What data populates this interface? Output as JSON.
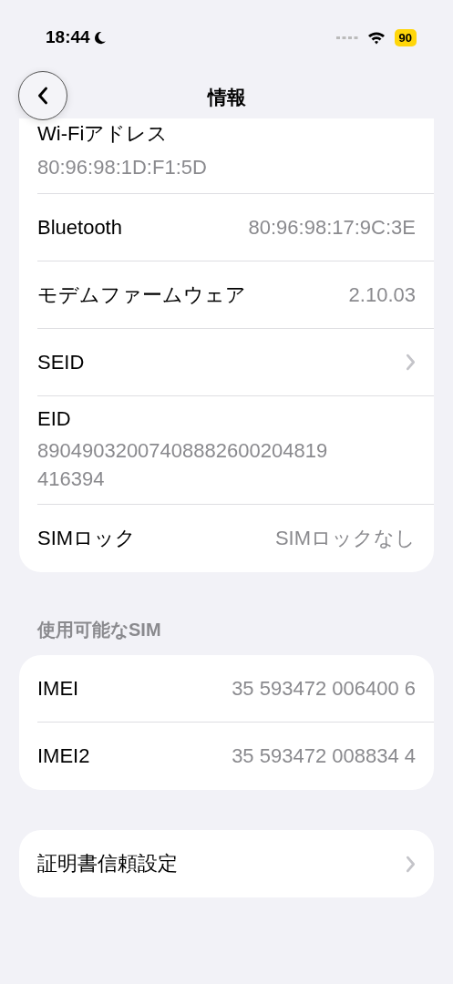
{
  "status_bar": {
    "time": "18:44",
    "battery": "90"
  },
  "nav": {
    "title": "情報"
  },
  "groups": [
    {
      "rows": [
        {
          "kind": "stacked",
          "label": "Wi-Fiアドレス",
          "value": "80:96:98:1D:F1:5D"
        },
        {
          "kind": "value",
          "label": "Bluetooth",
          "value": "80:96:98:17:9C:3E"
        },
        {
          "kind": "value",
          "label": "モデムファームウェア",
          "value": "2.10.03"
        },
        {
          "kind": "link",
          "label": "SEID"
        },
        {
          "kind": "stacked",
          "label": "EID",
          "value": "89049032007408882600204819416394"
        },
        {
          "kind": "value",
          "label": "SIMロック",
          "value": "SIMロックなし"
        }
      ]
    },
    {
      "header": "使用可能なSIM",
      "rows": [
        {
          "kind": "value",
          "label": "IMEI",
          "value": "35 593472 006400 6"
        },
        {
          "kind": "value",
          "label": "IMEI2",
          "value": "35 593472 008834 4"
        }
      ]
    },
    {
      "rows": [
        {
          "kind": "link",
          "label": "証明書信頼設定"
        }
      ]
    }
  ]
}
